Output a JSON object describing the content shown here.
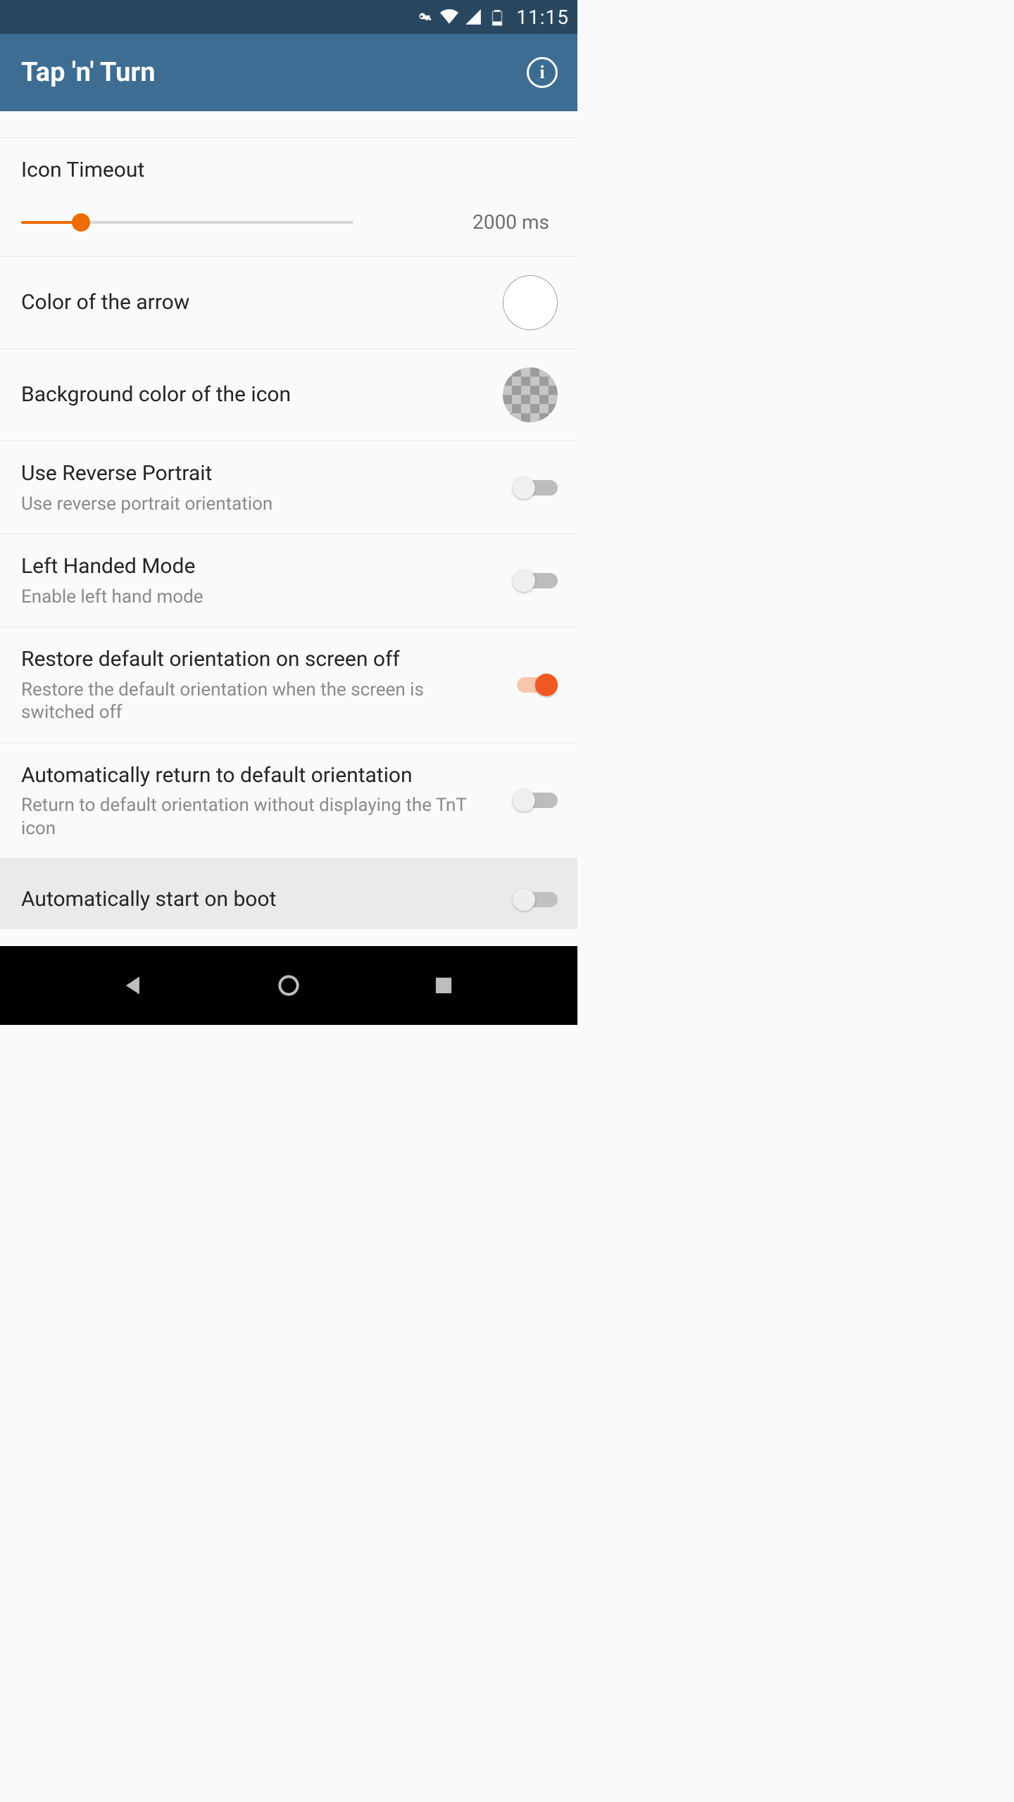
{
  "status": {
    "time": "11:15"
  },
  "appbar": {
    "title": "Tap 'n' Turn"
  },
  "settings": {
    "icon_timeout": {
      "title": "Icon Timeout",
      "value_label": "2000 ms",
      "fill_pct": "18%"
    },
    "arrow_color": {
      "title": "Color of the arrow",
      "color": "#ffffff"
    },
    "bg_color": {
      "title": "Background color of the icon"
    },
    "reverse_portrait": {
      "title": "Use Reverse Portrait",
      "subtitle": "Use reverse portrait orientation",
      "on": false
    },
    "left_handed": {
      "title": "Left Handed Mode",
      "subtitle": "Enable left hand mode",
      "on": false
    },
    "restore_default": {
      "title": "Restore default orientation on screen off",
      "subtitle": "Restore the default orientation when the screen is switched off",
      "on": true
    },
    "auto_return": {
      "title": "Automatically return to default orientation",
      "subtitle": "Return to default orientation without displaying the TnT icon",
      "on": false
    },
    "start_on_boot": {
      "title": "Automatically start on boot",
      "on": false
    }
  }
}
